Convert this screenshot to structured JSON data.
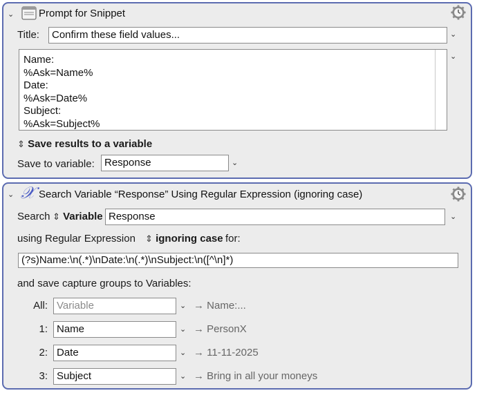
{
  "panel1": {
    "title": "Prompt for Snippet",
    "icon": "window-icon",
    "title_label": "Title:",
    "title_value": "Confirm these field values...",
    "snippet_lines": [
      "Name:",
      "%Ask=Name%",
      "Date:",
      "%Ask=Date%",
      "Subject:",
      "%Ask=Subject%"
    ],
    "save_results_toggle": "Save results to a variable",
    "save_to_label": "Save to variable:",
    "save_to_value": "Response"
  },
  "panel2": {
    "title": "Search Variable “Response” Using Regular Expression (ignoring case)",
    "icon_glyph": "𝒳",
    "search_label": "Search",
    "search_mode": "Variable",
    "search_value": "Response",
    "using_label": "using Regular Expression",
    "case_mode": "ignoring case",
    "for_label": "for:",
    "regex": "(?s)Name:\\n(.*)\\nDate:\\n(.*)\\nSubject:\\n([^\\n]*)",
    "capture_label": "and save capture groups to Variables:",
    "groups": [
      {
        "label": "All:",
        "value": "",
        "placeholder": "Variable",
        "result": "→ Name:..."
      },
      {
        "label": "1:",
        "value": "Name",
        "placeholder": "",
        "result": "→ PersonX"
      },
      {
        "label": "2:",
        "value": "Date",
        "placeholder": "",
        "result": "→ 11-11-2025"
      },
      {
        "label": "3:",
        "value": "Subject",
        "placeholder": "",
        "result": "→ Bring in all your moneys"
      }
    ]
  },
  "colors": {
    "panel_border": "#5b6bb0",
    "panel_bg": "#ececec",
    "regex_icon": "#4a5bc4"
  }
}
